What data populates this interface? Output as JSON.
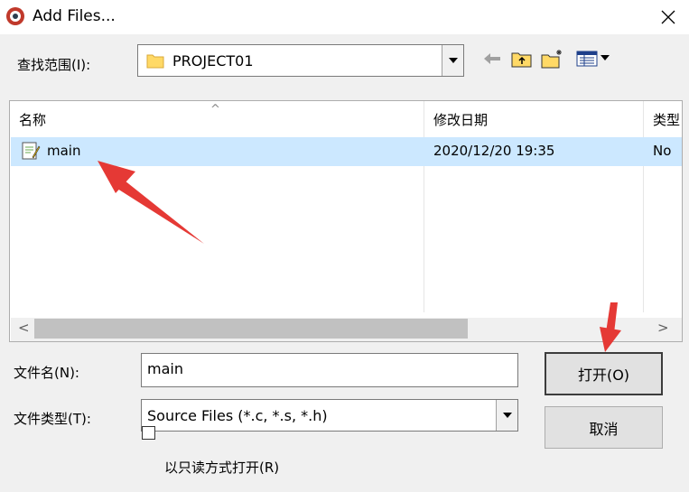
{
  "window": {
    "title": "Add Files..."
  },
  "lookin": {
    "label": "查找范围(I):",
    "value": "PROJECT01"
  },
  "filelist": {
    "columns": [
      "名称",
      "修改日期",
      "类型"
    ],
    "rows": [
      {
        "name": "main",
        "modified": "2020/12/20 19:35",
        "type": "No"
      }
    ]
  },
  "filename": {
    "label": "文件名(N):",
    "value": "main"
  },
  "filetype": {
    "label": "文件类型(T):",
    "value": "Source Files (*.c, *.s, *.h)"
  },
  "buttons": {
    "open": "打开(O)",
    "cancel": "取消"
  },
  "readonly": {
    "label": "以只读方式打开(R)",
    "checked": false
  },
  "colors": {
    "selection": "#cce8ff",
    "annotation": "#e53935"
  }
}
